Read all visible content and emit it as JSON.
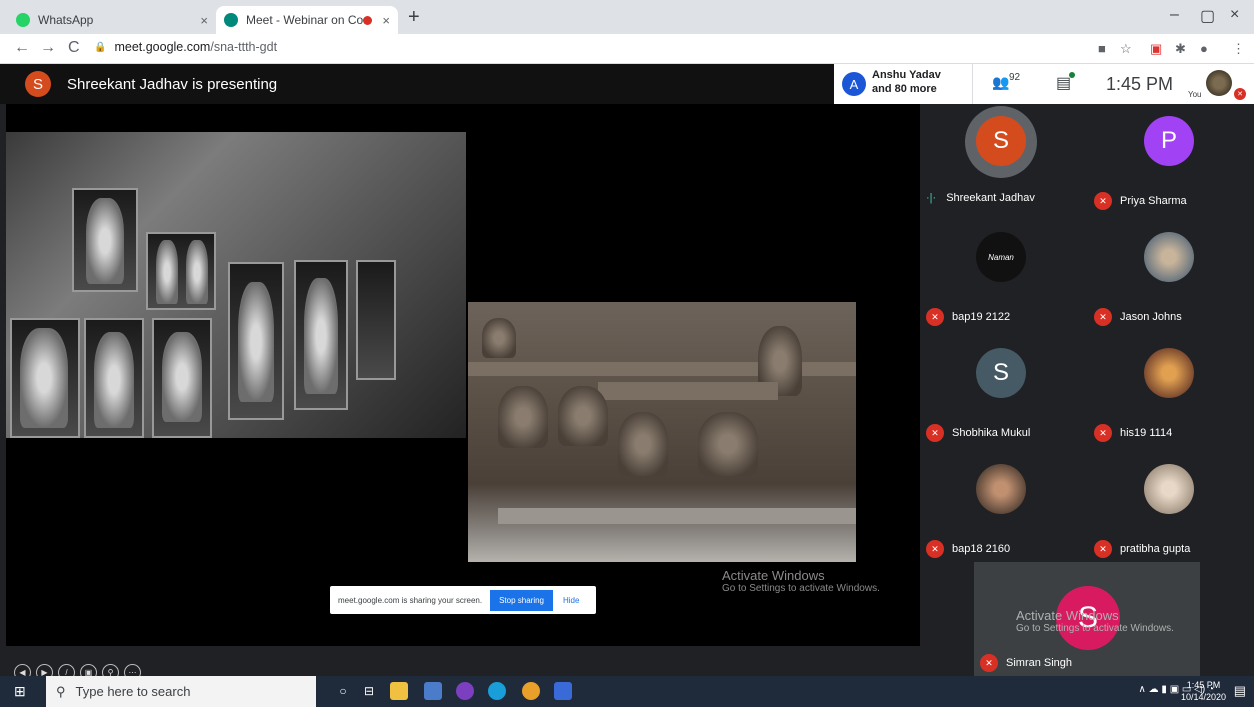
{
  "browser": {
    "tabs": [
      {
        "title": "WhatsApp",
        "close": "×"
      },
      {
        "title": "Meet - Webinar on Conserva",
        "close": "×"
      }
    ],
    "new_tab": "+",
    "window_controls": {
      "minimize": "–",
      "maximize": "▢",
      "close": "×"
    },
    "nav": {
      "back": "←",
      "forward": "→",
      "reload": "C"
    },
    "url_host": "meet.google.com",
    "url_path": "/sna-ttth-gdt"
  },
  "meet": {
    "presenter_initial": "S",
    "presenter_text": "Shreekant Jadhav is presenting",
    "people_avatar": "A",
    "people_line1": "Anshu Yadav",
    "people_line2": "and 80 more",
    "participant_count": "92",
    "time": "1:45 PM",
    "you_label": "You",
    "sharing_banner": {
      "text": "meet.google.com is sharing your screen.",
      "stop_label": "Stop sharing",
      "hide_label": "Hide"
    },
    "activate_windows": {
      "line1": "Activate Windows",
      "line2": "Go to Settings to activate Windows."
    },
    "participants": [
      {
        "initial": "S",
        "name": "Shreekant Jadhav",
        "color": "#d44c1e",
        "speaking": true
      },
      {
        "initial": "P",
        "name": "Priya Sharma",
        "color": "#a142f4",
        "speaking": false
      },
      {
        "initial": "Naman",
        "name": "bap19 2122",
        "color": "#111111",
        "speaking": false
      },
      {
        "initial": "",
        "name": "Jason Johns",
        "color": "#6a7a8a",
        "speaking": false
      },
      {
        "initial": "S",
        "name": "Shobhika Mukul",
        "color": "#455a64",
        "speaking": false
      },
      {
        "initial": "",
        "name": "his19 1114",
        "color": "#8a5a3a",
        "speaking": false
      },
      {
        "initial": "",
        "name": "bap18 2160",
        "color": "#7a5a4a",
        "speaking": false
      },
      {
        "initial": "",
        "name": "pratibha gupta",
        "color": "#b0a090",
        "speaking": false
      },
      {
        "initial": "S",
        "name": "Simran Singh",
        "color": "#d81b60",
        "speaking": false
      }
    ]
  },
  "taskbar": {
    "search_placeholder": "Type here to search",
    "time": "1:45 PM",
    "date": "10/14/2020"
  }
}
